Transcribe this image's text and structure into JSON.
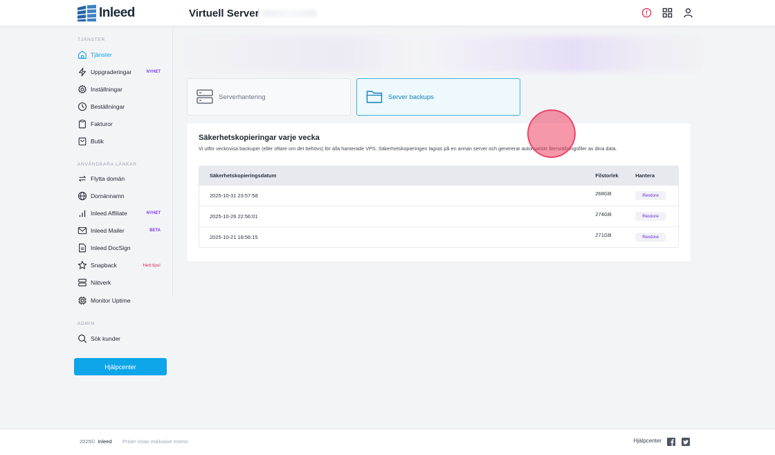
{
  "brand": {
    "name": "Inleed"
  },
  "header": {
    "title": "Virtuell Server"
  },
  "sidebar": {
    "sections": [
      {
        "title": "TJÄNSTER"
      },
      {
        "title": "ANVÄNDBARA LÄNKAR"
      },
      {
        "title": "ADMIN"
      }
    ],
    "items": [
      {
        "label": "Tjänster",
        "icon": "home-icon",
        "badge": ""
      },
      {
        "label": "Uppgraderingar",
        "icon": "lightning-icon",
        "badge": "NYHET"
      },
      {
        "label": "Inställningar",
        "icon": "gear-icon",
        "badge": ""
      },
      {
        "label": "Beställningar",
        "icon": "clock-icon",
        "badge": ""
      },
      {
        "label": "Fakturor",
        "icon": "clipboard-icon",
        "badge": ""
      },
      {
        "label": "Butik",
        "icon": "shopping-bag-icon",
        "badge": ""
      },
      {
        "label": "Flytta domän",
        "icon": "swap-icon",
        "badge": ""
      },
      {
        "label": "Domännamn",
        "icon": "globe-icon",
        "badge": ""
      },
      {
        "label": "Inleed Affiliate",
        "icon": "bar-chart-icon",
        "badge": "NYHET"
      },
      {
        "label": "Inleed Mailer",
        "icon": "mail-icon",
        "badge": "BETA"
      },
      {
        "label": "Inleed DocSign",
        "icon": "document-icon",
        "badge": ""
      },
      {
        "label": "Snapback",
        "icon": "star-icon",
        "badge": "Hett tips!"
      },
      {
        "label": "Nätverk",
        "icon": "server-icon",
        "badge": ""
      },
      {
        "label": "Monitor Uptime",
        "icon": "chip-icon",
        "badge": ""
      },
      {
        "label": "Sök kunder",
        "icon": "search-icon",
        "badge": ""
      }
    ],
    "help_button": "Hjälpcenter"
  },
  "tabs": [
    {
      "label": "Serverhantering",
      "icon": "server-icon"
    },
    {
      "label": "Server backups",
      "icon": "folder-icon"
    }
  ],
  "backups": {
    "title": "Säkerhetskopieringar varje vecka",
    "description": "Vi utför veckovisa backuper (eller oftare om det behövs) för alla hanterade VPS. Säkerhetskopieringen lagras på en annan server och genererar automatiskt återställningsfiler av dina data.",
    "columns": [
      "Säkerhetskopieringsdatum",
      "Filstorlek",
      "Hantera"
    ],
    "rows": [
      {
        "date": "2025-10-31 23:57:58",
        "size": "268GB",
        "action": "Restore"
      },
      {
        "date": "2025-10-26 22:56:01",
        "size": "274GB",
        "action": "Restore"
      },
      {
        "date": "2025-10-21 18:56:15",
        "size": "271GB",
        "action": "Restore"
      }
    ]
  },
  "footer": {
    "copyright": "2025©",
    "brand": "Inleed",
    "note": "Priser visas exklusive moms.",
    "help": "Hjälpcenter"
  },
  "colors": {
    "accent": "#0ea5e9",
    "badge": "#7c3aed",
    "hot": "#e0245e",
    "info": "#e11d48"
  }
}
